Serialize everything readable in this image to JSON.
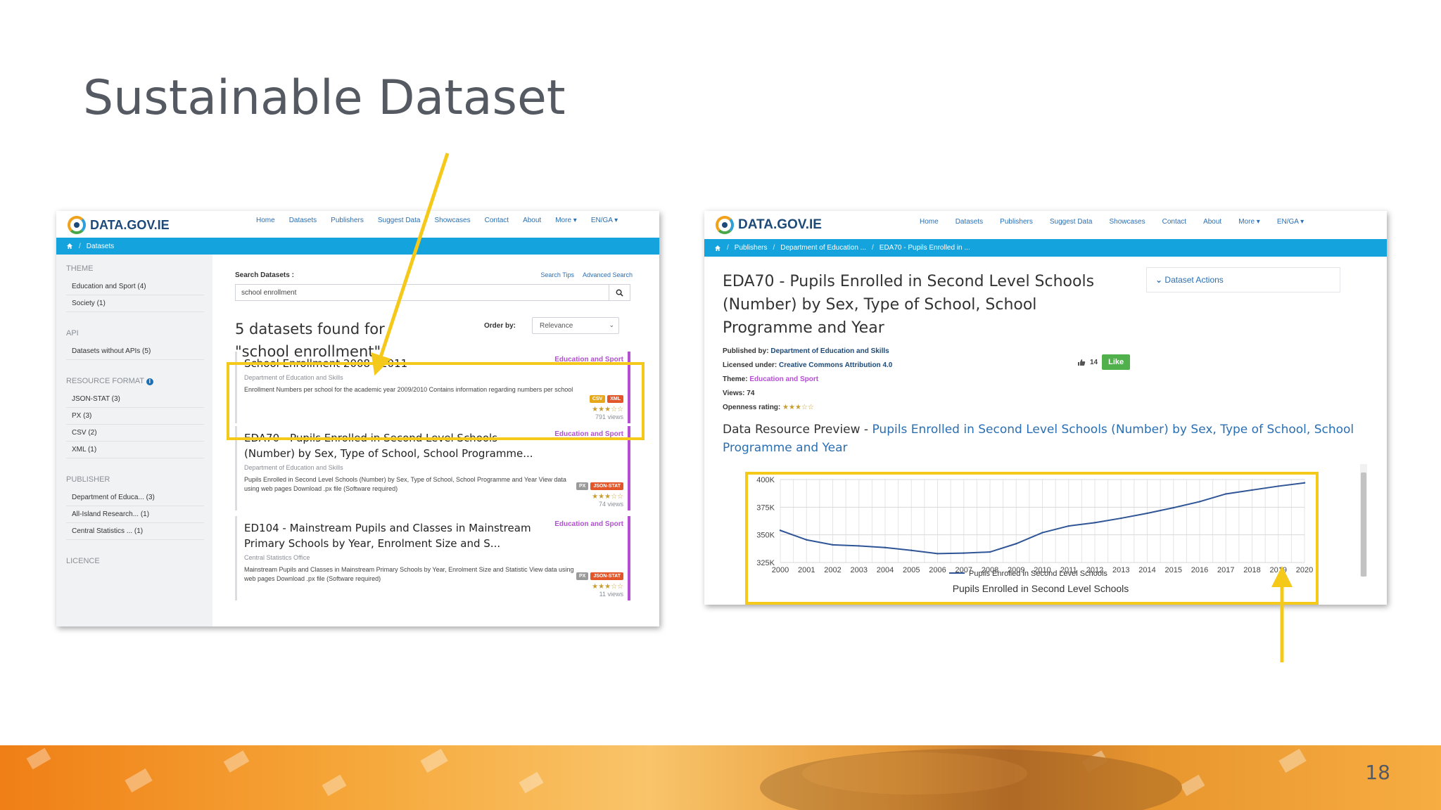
{
  "slide": {
    "title": "Sustainable Dataset",
    "page_number": "18"
  },
  "left_site": {
    "logo_text": "DATA.GOV.IE",
    "nav": [
      "Home",
      "Datasets",
      "Publishers",
      "Suggest Data",
      "Showcases",
      "Contact",
      "About",
      "More ▾",
      "EN/GA ▾"
    ],
    "breadcrumb": [
      "Datasets"
    ],
    "sidebar": {
      "theme_heading": "THEME",
      "theme_items": [
        "Education and Sport (4)",
        "Society (1)"
      ],
      "api_heading": "API",
      "api_items": [
        "Datasets without APIs (5)"
      ],
      "format_heading": "RESOURCE FORMAT",
      "format_items": [
        "JSON-STAT (3)",
        "PX (3)",
        "CSV (2)",
        "XML (1)"
      ],
      "publisher_heading": "PUBLISHER",
      "publisher_items": [
        "Department of Educa... (3)",
        "All-Island Research... (1)",
        "Central Statistics ... (1)"
      ],
      "licence_heading": "LICENCE"
    },
    "search": {
      "label": "Search Datasets :",
      "tips": "Search Tips",
      "advanced": "Advanced Search",
      "query": "school enrollment"
    },
    "results_count": "5 datasets found for \"school enrollment\"",
    "order_label": "Order by:",
    "order_value": "Relevance",
    "results": [
      {
        "title": "School Enrollment 2008 - 2011",
        "theme": "Education and Sport",
        "publisher": "Department of Education and Skills",
        "description": "Enrollment Numbers per school for the academic year 2009/2010 Contains information regarding numbers per school",
        "badges": [
          "CSV",
          "XML"
        ],
        "stars": "★★★☆☆",
        "views": "791 views"
      },
      {
        "title": "EDA70 - Pupils Enrolled in Second Level Schools (Number) by Sex, Type of School, School Programme...",
        "theme": "Education and Sport",
        "publisher": "Department of Education and Skills",
        "description": "Pupils Enrolled in Second Level Schools (Number) by Sex, Type of School, School Programme and Year View data using web pages Download .px file (Software required)",
        "badges": [
          "PX",
          "JSON-STAT"
        ],
        "stars": "★★★☆☆",
        "views": "74 views"
      },
      {
        "title": "ED104 - Mainstream Pupils and Classes in Mainstream Primary Schools by Year, Enrolment Size and S...",
        "theme": "Education and Sport",
        "publisher": "Central Statistics Office",
        "description": "Mainstream Pupils and Classes in Mainstream Primary Schools by Year, Enrolment Size and Statistic View data using web pages Download .px file (Software required)",
        "badges": [
          "PX",
          "JSON-STAT"
        ],
        "stars": "★★★☆☆",
        "views": "11 views"
      }
    ]
  },
  "right_site": {
    "logo_text": "DATA.GOV.IE",
    "nav": [
      "Home",
      "Datasets",
      "Publishers",
      "Suggest Data",
      "Showcases",
      "Contact",
      "About",
      "More ▾",
      "EN/GA ▾"
    ],
    "breadcrumb": [
      "Publishers",
      "Department of Education ...",
      "EDA70 - Pupils Enrolled in ..."
    ],
    "dataset_title": "EDA70 - Pupils Enrolled in Second Level Schools (Number) by Sex, Type of School, School Programme and Year",
    "dataset_actions": "Dataset Actions",
    "published_by_label": "Published by:",
    "published_by": "Department of Education and Skills",
    "licensed_label": "Licensed under:",
    "licensed": "Creative Commons Attribution 4.0",
    "theme_label": "Theme:",
    "theme": "Education and Sport",
    "views": "Views: 74",
    "openness_label": "Openness rating:",
    "openness_stars": "★★★☆☆",
    "like_count": "14",
    "like_label": "Like",
    "preview_prefix": "Data Resource Preview - ",
    "preview_link": "Pupils Enrolled in Second Level Schools (Number) by Sex, Type of School, School Programme and Year"
  },
  "colors": {
    "accent_blue": "#14a3dc",
    "theme_purple": "#b44ed3",
    "highlight_yellow": "#f5c919",
    "like_green": "#4fb04c"
  },
  "chart_data": {
    "type": "line",
    "x": [
      2000,
      2001,
      2002,
      2003,
      2004,
      2005,
      2006,
      2007,
      2008,
      2009,
      2010,
      2011,
      2012,
      2013,
      2014,
      2015,
      2016,
      2017,
      2018,
      2019,
      2020
    ],
    "series": [
      {
        "name": "Pupils Enrolled in Second Level Schools",
        "values": [
          354000,
          345500,
          341000,
          340000,
          338500,
          336000,
          333000,
          333500,
          334500,
          342000,
          352000,
          358000,
          361000,
          365000,
          369500,
          374500,
          380000,
          387000,
          390500,
          394000,
          397000
        ]
      }
    ],
    "x_tick_labels": [
      "2000",
      "2001",
      "2002",
      "2003",
      "2004",
      "2005",
      "2006",
      "2007",
      "2008",
      "2009",
      "2010",
      "2011",
      "2012",
      "2013",
      "2014",
      "2015",
      "2016",
      "2017",
      "2018",
      "2019",
      "2020"
    ],
    "y_tick_labels": [
      "325K",
      "350K",
      "375K",
      "400K"
    ],
    "ylim": [
      325000,
      400000
    ],
    "legend": "Pupils Enrolled in Second Level Schools",
    "legend_position": "bottom",
    "title": "Pupils Enrolled in Second Level Schools",
    "grid": true,
    "line_color": "#2f5597"
  }
}
